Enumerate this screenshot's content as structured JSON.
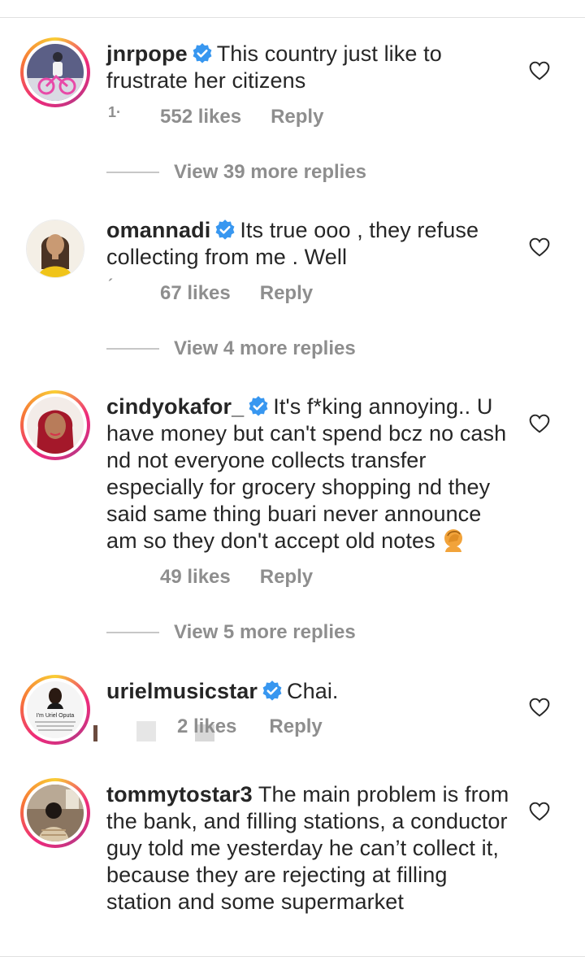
{
  "comments": [
    {
      "username": "jnrpope",
      "verified": true,
      "text": "This country just like to frustrate her citizens",
      "time_fragment": "1·",
      "likes": "552 likes",
      "reply": "Reply",
      "view_replies": "View 39 more replies",
      "avatar": "person-on-pink-bicycle"
    },
    {
      "username": "omannadi",
      "verified": true,
      "text": "Its true ooo , they refuse collecting from me . Well",
      "time_fragment": "´",
      "likes": "67 likes",
      "reply": "Reply",
      "view_replies": "View 4 more replies",
      "avatar": "woman-yellow-top-illustration"
    },
    {
      "username": "cindyokafor_",
      "verified": true,
      "text": "It's f*king annoying.. U have money but can't spend bcz no cash nd not everyone collects transfer especially for grocery shopping nd they said same thing buari never announce am so they don't accept old notes",
      "emoji": "facepalm",
      "likes": "49 likes",
      "reply": "Reply",
      "view_replies": "View 5 more replies",
      "avatar": "woman-red-hair"
    },
    {
      "username": "urielmusicstar",
      "verified": true,
      "text": "Chai.",
      "likes": "2 likes",
      "reply": "Reply",
      "avatar": "im-uriel-oputa-card",
      "avatar_caption": "I'm Uriel Oputa"
    },
    {
      "username": "tommytostar3",
      "verified": false,
      "text": "The main problem is from the bank, and filling stations, a conductor guy told me yesterday he can’t collect it, because they are rejecting at filling station and some supermarket",
      "avatar": "man-back-view-indoor"
    }
  ],
  "icons": {
    "verified": "verified-badge-icon",
    "heart": "heart-outline-icon"
  },
  "colors": {
    "text": "#262626",
    "muted": "#8e8e8e",
    "verified": "#3897f0",
    "story_ring": [
      "#f9ce34",
      "#ee2a7b",
      "#c13584"
    ]
  }
}
